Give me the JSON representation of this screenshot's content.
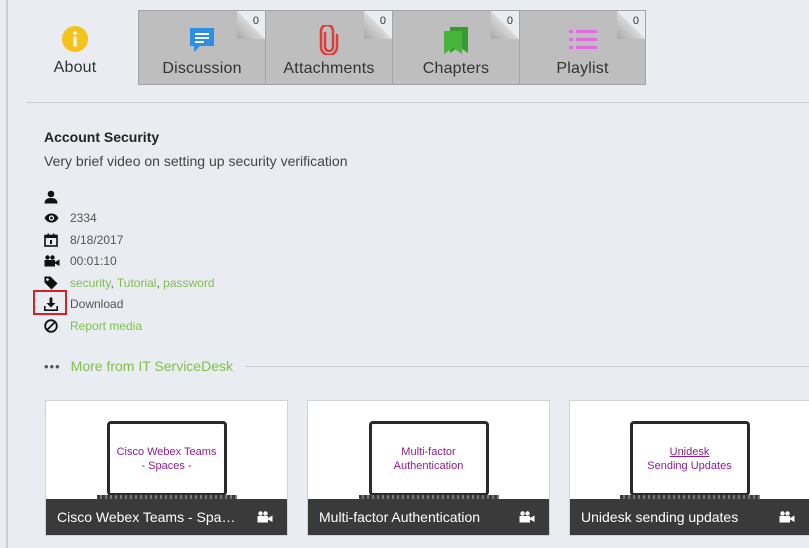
{
  "tabs": [
    {
      "label": "About",
      "active": true,
      "icon": "info-icon",
      "color": "#f6c21c"
    },
    {
      "label": "Discussion",
      "count": "0",
      "icon": "chat-icon",
      "color": "#2d8fe3"
    },
    {
      "label": "Attachments",
      "count": "0",
      "icon": "paperclip-icon",
      "color": "#e03b3b"
    },
    {
      "label": "Chapters",
      "count": "0",
      "icon": "bookmarks-icon",
      "color": "#47b43c"
    },
    {
      "label": "Playlist",
      "count": "0",
      "icon": "list-icon",
      "color": "#e26ae2"
    }
  ],
  "media": {
    "title": "Account Security",
    "description": "Very brief video on setting up security verification",
    "views": "2334",
    "date": "8/18/2017",
    "duration": "00:01:10",
    "tags": [
      "security",
      "Tutorial",
      "password"
    ],
    "download_label": "Download",
    "report_label": "Report media"
  },
  "more": {
    "dots": "•••",
    "label": "More from IT ServiceDesk"
  },
  "cards": [
    {
      "title": "Cisco Webex Teams - Spa…",
      "thumb_line1": "Cisco Webex Teams",
      "thumb_line2": "- Spaces -"
    },
    {
      "title": "Multi-factor Authentication",
      "thumb_line1": "Multi-factor",
      "thumb_line2": "Authentication"
    },
    {
      "title": "Unidesk sending updates",
      "thumb_line1": "Unidesk",
      "thumb_line2": "Sending Updates"
    }
  ],
  "colors": {
    "accent_green": "#7fbf4d",
    "highlight_red": "#d61f26"
  }
}
